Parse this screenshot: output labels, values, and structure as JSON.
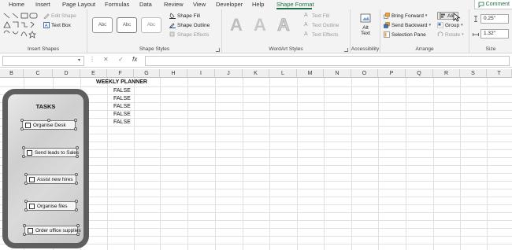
{
  "tabs": [
    {
      "label": "Home",
      "active": false
    },
    {
      "label": "Insert",
      "active": false
    },
    {
      "label": "Page Layout",
      "active": false
    },
    {
      "label": "Formulas",
      "active": false
    },
    {
      "label": "Data",
      "active": false
    },
    {
      "label": "Review",
      "active": false
    },
    {
      "label": "View",
      "active": false
    },
    {
      "label": "Developer",
      "active": false
    },
    {
      "label": "Help",
      "active": false
    },
    {
      "label": "Shape Format",
      "active": true
    }
  ],
  "comments_label": "Comment",
  "ribbon": {
    "insert_shapes": {
      "label": "Insert Shapes",
      "edit_shape": "Edit Shape",
      "text_box": "Text Box"
    },
    "shape_styles": {
      "label": "Shape Styles",
      "fill": "Shape Fill",
      "outline": "Shape Outline",
      "effects": "Shape Effects",
      "style_sample": "Abc"
    },
    "wordart": {
      "label": "WordArt Styles",
      "text_fill": "Text Fill",
      "text_outline": "Text Outline",
      "text_effects": "Text Effects",
      "sample": "A"
    },
    "accessibility": {
      "label": "Accessibility",
      "alt_text_1": "Alt",
      "alt_text_2": "Text"
    },
    "arrange": {
      "label": "Arrange",
      "bring_forward": "Bring Forward",
      "send_backward": "Send Backward",
      "selection_pane": "Selection Pane",
      "align": "Alig",
      "group": "Group",
      "rotate": "Rotate"
    },
    "size": {
      "label": "Size",
      "height": "0.25\"",
      "width": "1.32\""
    }
  },
  "formula": {
    "name_box": "",
    "cancel": "✕",
    "enter": "✓",
    "fx": "fx",
    "value": ""
  },
  "columns": [
    "B",
    "C",
    "D",
    "E",
    "F",
    "G",
    "H",
    "I",
    "J",
    "K",
    "L",
    "M",
    "N",
    "O",
    "P",
    "Q",
    "R",
    "S",
    "T"
  ],
  "sheet": {
    "heading": "WEEKLY PLANNER",
    "false_values": [
      "FALSE",
      "FALSE",
      "FALSE",
      "FALSE",
      "FALSE"
    ]
  },
  "phone": {
    "title": "TASKS",
    "tasks": [
      "Organise Desk",
      "Send leads to Sales",
      "Assist new hires",
      "Organise files",
      "Order office supplies"
    ]
  },
  "colors": {
    "accent": "#1e7145",
    "phone_frame": "#5e5e5e"
  }
}
